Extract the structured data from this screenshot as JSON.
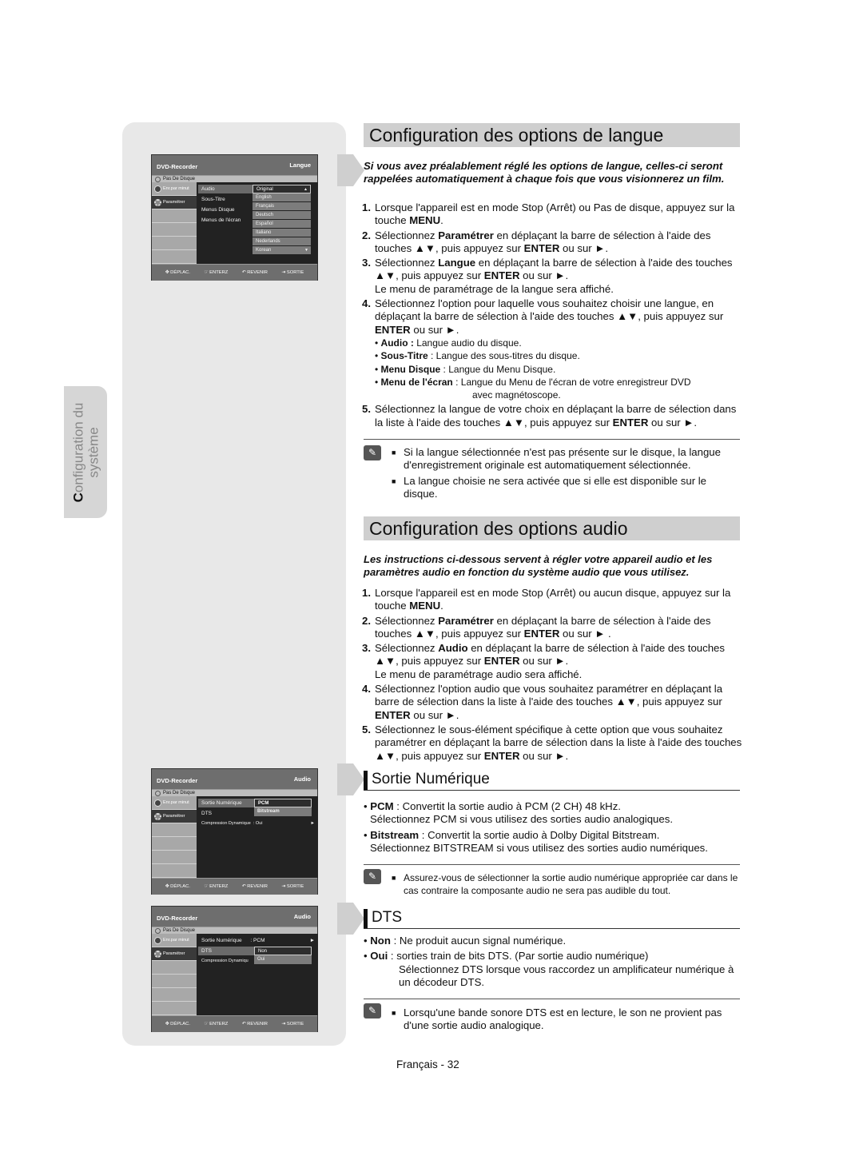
{
  "side_tab": {
    "label_line1": "Configuration du",
    "label_line2": "système",
    "first_letter": "C"
  },
  "screens": [
    {
      "header_left": "DVD-Recorder",
      "header_right": "Langue",
      "disc_status": "Pas De Disque",
      "side_items": [
        "Enr.par minut",
        "Paramétrer"
      ],
      "menu_items": [
        "Audio",
        "Sous-Titre",
        "Menus Disque",
        "Menus de l'écran"
      ],
      "list_options": [
        "Original",
        "English",
        "Français",
        "Deutsch",
        "Español",
        "Italiano",
        "Nederlands",
        "Korean"
      ],
      "footer": [
        "DÉPLAC.",
        "ENTERZ",
        "REVENIR",
        "SORTIE"
      ]
    },
    {
      "header_left": "DVD-Recorder",
      "header_right": "Audio",
      "disc_status": "Pas De Disque",
      "side_items": [
        "Enr.par minut",
        "Paramétrer"
      ],
      "menu_items": [
        "Sortie Numérique",
        "DTS",
        "Compression Dynamique"
      ],
      "menu_values": [
        "",
        "",
        ": Oui"
      ],
      "list_options": [
        "PCM",
        "Bitstream"
      ],
      "footer": [
        "DÉPLAC.",
        "ENTERZ",
        "REVENIR",
        "SORTIE"
      ]
    },
    {
      "header_left": "DVD-Recorder",
      "header_right": "Audio",
      "disc_status": "Pas De Disque",
      "side_items": [
        "Enr.par minut",
        "Paramétrer"
      ],
      "menu_items": [
        "Sortie Numérique",
        "DTS",
        "Compression Dynamiqu"
      ],
      "menu_values": [
        ": PCM",
        "",
        ""
      ],
      "list_options": [
        "Non",
        "Oui"
      ],
      "footer": [
        "DÉPLAC.",
        "ENTERZ",
        "REVENIR",
        "SORTIE"
      ]
    }
  ],
  "langue": {
    "title": "Configuration des options de langue",
    "intro": "Si vous avez préalablement réglé les options de langue, celles-ci seront rappelées automatiquement à chaque fois que vous visionnerez un film.",
    "steps": [
      {
        "num": "1.",
        "pre": "Lorsque l'appareil est en mode Stop (Arrêt) ou Pas de disque, appuyez sur la touche ",
        "bold": "MENU",
        "post": "."
      },
      {
        "num": "2.",
        "pre": "Sélectionnez ",
        "bold": "Paramétrer",
        "mid": " en déplaçant la barre de sélection à l'aide des touches ▲▼, puis appuyez sur ",
        "bold2": "ENTER",
        "post": " ou sur ►."
      },
      {
        "num": "3.",
        "pre": "Sélectionnez ",
        "bold": "Langue",
        "mid": " en déplaçant la barre de sélection à l'aide des touches ▲▼, puis appuyez sur ",
        "bold2": "ENTER",
        "post": " ou sur ►.",
        "extra": "Le menu de paramétrage de la langue sera affiché."
      },
      {
        "num": "4.",
        "pre": "Sélectionnez l'option pour laquelle vous souhaitez choisir une langue, en déplaçant la barre de sélection à l'aide des touches ▲▼, puis appuyez sur ",
        "bold": "ENTER",
        "post": " ou sur ►."
      },
      {
        "num": "5.",
        "pre": "Sélectionnez la langue de votre choix en déplaçant la barre de sélection dans la liste à l'aide des touches ▲▼, puis appuyez sur ",
        "bold": "ENTER",
        "post": " ou sur ►."
      }
    ],
    "bullets": [
      {
        "term": "Audio :",
        "desc": " Langue audio du disque."
      },
      {
        "term": "Sous-Titre",
        "desc": " : Langue des sous-titres du disque."
      },
      {
        "term": "Menu Disque",
        "desc": " : Langue du Menu Disque."
      },
      {
        "term": "Menu de l'écran",
        "desc": " : Langue du Menu de l'écran de votre enregistreur DVD",
        "cont": "avec magnétoscope."
      }
    ],
    "notes": [
      "Si la langue sélectionnée n'est pas présente sur le disque, la langue d'enregistrement originale est automatiquement sélectionnée.",
      "La langue choisie ne sera activée que si elle est disponible sur le disque."
    ]
  },
  "audio": {
    "title": "Configuration des options audio",
    "intro": "Les instructions ci-dessous servent à régler votre appareil audio et les paramètres audio en fonction du système audio que vous utilisez.",
    "steps": [
      {
        "num": "1.",
        "pre": "Lorsque l'appareil est en mode Stop (Arrêt) ou aucun disque, appuyez sur la touche ",
        "bold": "MENU",
        "post": "."
      },
      {
        "num": "2.",
        "pre": "Sélectionnez ",
        "bold": "Paramétrer",
        "mid": " en déplaçant la barre de sélection à l'aide des touches ▲▼, puis appuyez sur ",
        "bold2": "ENTER",
        "post": " ou sur ► ."
      },
      {
        "num": "3.",
        "pre": "Sélectionnez ",
        "bold": "Audio",
        "mid": " en déplaçant la barre de sélection à l'aide des touches ▲▼, puis appuyez sur ",
        "bold2": "ENTER",
        "post": " ou sur ►.",
        "extra": "Le menu de paramétrage audio sera affiché."
      },
      {
        "num": "4.",
        "pre": "Sélectionnez l'option audio que vous souhaitez paramétrer en déplaçant la barre de sélection dans la liste à l'aide des touches ▲▼, puis appuyez sur ",
        "bold": "ENTER",
        "post": " ou sur ►."
      },
      {
        "num": "5.",
        "pre": "Sélectionnez le sous-élément spécifique à cette option que vous souhaitez paramétrer en déplaçant la barre de sélection dans la liste à l'aide des touches ▲▼, puis appuyez sur ",
        "bold": "ENTER",
        "post": " ou sur ►."
      }
    ]
  },
  "sortie": {
    "title": "Sortie Numérique",
    "defs": [
      {
        "term": "PCM",
        "desc": " : Convertit la sortie audio à PCM (2 CH) 48 kHz.",
        "cont": "Sélectionnez PCM si vous utilisez des sorties audio analogiques."
      },
      {
        "term": "Bitstream",
        "desc": " : Convertit la sortie audio à Dolby Digital Bitstream.",
        "cont": "Sélectionnez BITSTREAM si vous utilisez des sorties audio numériques."
      }
    ],
    "note": "Assurez-vous de sélectionner la sortie audio numérique appropriée car dans le cas contraire la composante audio ne sera pas audible du tout."
  },
  "dts": {
    "title": "DTS",
    "defs": [
      {
        "term": "Non",
        "desc": " : Ne produit aucun signal numérique."
      },
      {
        "term": "Oui",
        "desc": " : sorties train de bits DTS. (Par sortie audio numérique)",
        "cont": "Sélectionnez DTS lorsque vous raccordez un amplificateur numérique à un décodeur DTS."
      }
    ],
    "note": "Lorsqu'une bande sonore DTS est en lecture, le son ne provient pas d'une sortie audio analogique."
  },
  "icons": {
    "note": "pencil-note-icon",
    "square_bullet": "■"
  },
  "page_number": "Français - 32"
}
